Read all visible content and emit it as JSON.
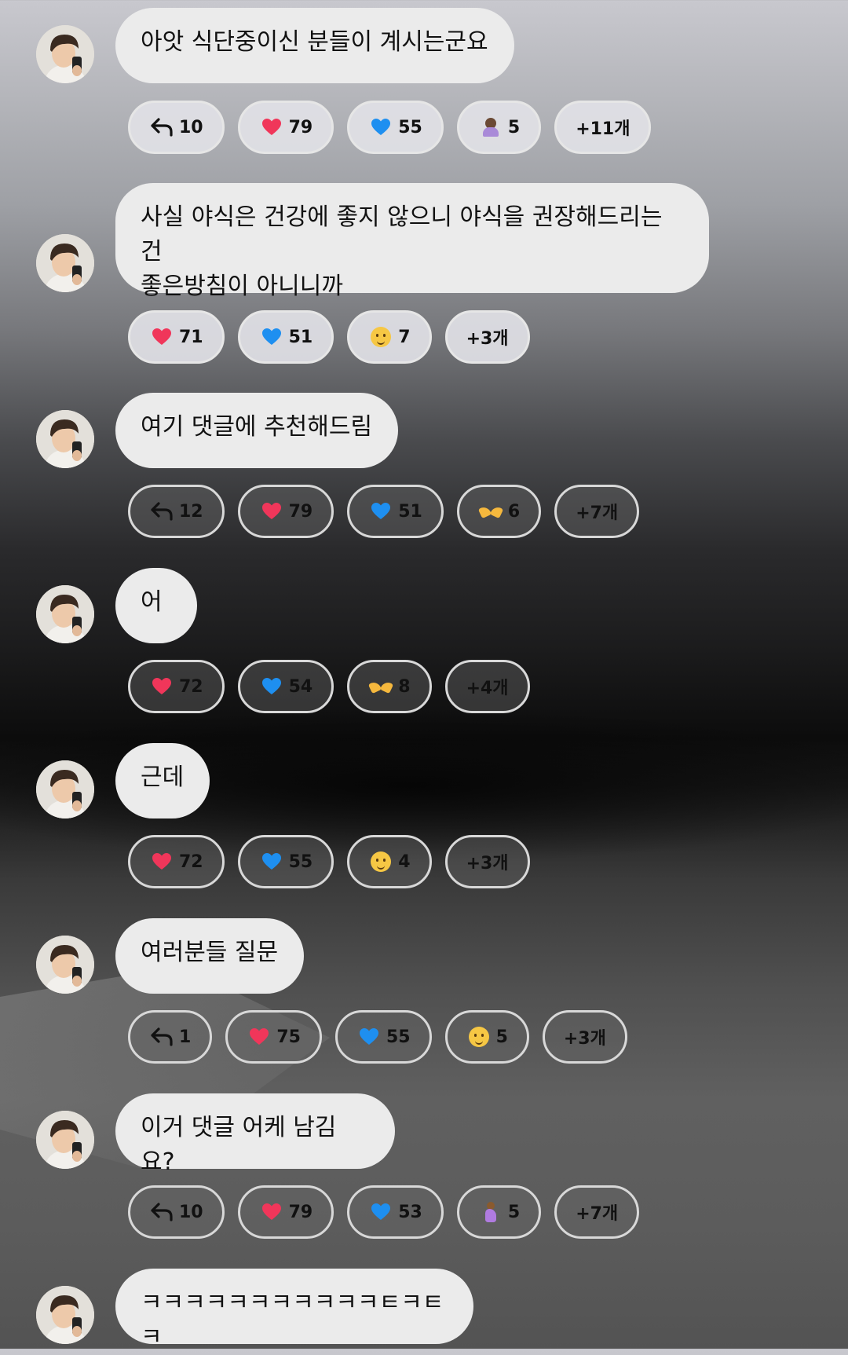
{
  "colors": {
    "heart": "#f0365a",
    "blue_heart": "#1e8ff0",
    "bubble": "#ebebeb"
  },
  "messages": [
    {
      "text": "아앗 식단중이신 분들이 계시는군요",
      "reactions": [
        {
          "icon": "reply-arrow-icon",
          "count": "10"
        },
        {
          "icon": "red-heart-icon",
          "count": "79"
        },
        {
          "icon": "blue-heart-icon",
          "count": "55"
        },
        {
          "icon": "person-gesture-emoji-icon",
          "count": "5"
        },
        {
          "icon": "",
          "count": "+11개"
        }
      ]
    },
    {
      "text": "사실 야식은 건강에 좋지 않으니 야식을 권장해드리는건\n좋은방침이 아니니까",
      "reactions": [
        {
          "icon": "red-heart-icon",
          "count": "71"
        },
        {
          "icon": "blue-heart-icon",
          "count": "51"
        },
        {
          "icon": "rofl-emoji-icon",
          "count": "7"
        },
        {
          "icon": "",
          "count": "+3개"
        }
      ]
    },
    {
      "text": "여기 댓글에 추천해드림",
      "reactions": [
        {
          "icon": "reply-arrow-icon",
          "count": "12"
        },
        {
          "icon": "red-heart-icon",
          "count": "79"
        },
        {
          "icon": "blue-heart-icon",
          "count": "51"
        },
        {
          "icon": "heart-hands-emoji-icon",
          "count": "6"
        },
        {
          "icon": "",
          "count": "+7개"
        }
      ]
    },
    {
      "text": "어",
      "reactions": [
        {
          "icon": "red-heart-icon",
          "count": "72"
        },
        {
          "icon": "blue-heart-icon",
          "count": "54"
        },
        {
          "icon": "heart-hands-emoji-icon",
          "count": "8"
        },
        {
          "icon": "",
          "count": "+4개"
        }
      ]
    },
    {
      "text": "근데",
      "reactions": [
        {
          "icon": "red-heart-icon",
          "count": "72"
        },
        {
          "icon": "blue-heart-icon",
          "count": "55"
        },
        {
          "icon": "thinking-face-emoji-icon",
          "count": "4"
        },
        {
          "icon": "",
          "count": "+3개"
        }
      ]
    },
    {
      "text": "여러분들 질문",
      "reactions": [
        {
          "icon": "reply-arrow-icon",
          "count": "1"
        },
        {
          "icon": "red-heart-icon",
          "count": "75"
        },
        {
          "icon": "blue-heart-icon",
          "count": "55"
        },
        {
          "icon": "thinking-face-emoji-icon",
          "count": "5"
        },
        {
          "icon": "",
          "count": "+3개"
        }
      ]
    },
    {
      "text": "이거 댓글 어케 남김요?",
      "reactions": [
        {
          "icon": "reply-arrow-icon",
          "count": "10"
        },
        {
          "icon": "red-heart-icon",
          "count": "79"
        },
        {
          "icon": "blue-heart-icon",
          "count": "53"
        },
        {
          "icon": "pregnant-person-emoji-icon",
          "count": "5"
        },
        {
          "icon": "",
          "count": "+7개"
        }
      ]
    },
    {
      "text": "ㅋㅋㅋㅋㅋㅋㅋㅋㅋㅋㅋㅌㅋㅌㅋ",
      "reactions": []
    }
  ]
}
